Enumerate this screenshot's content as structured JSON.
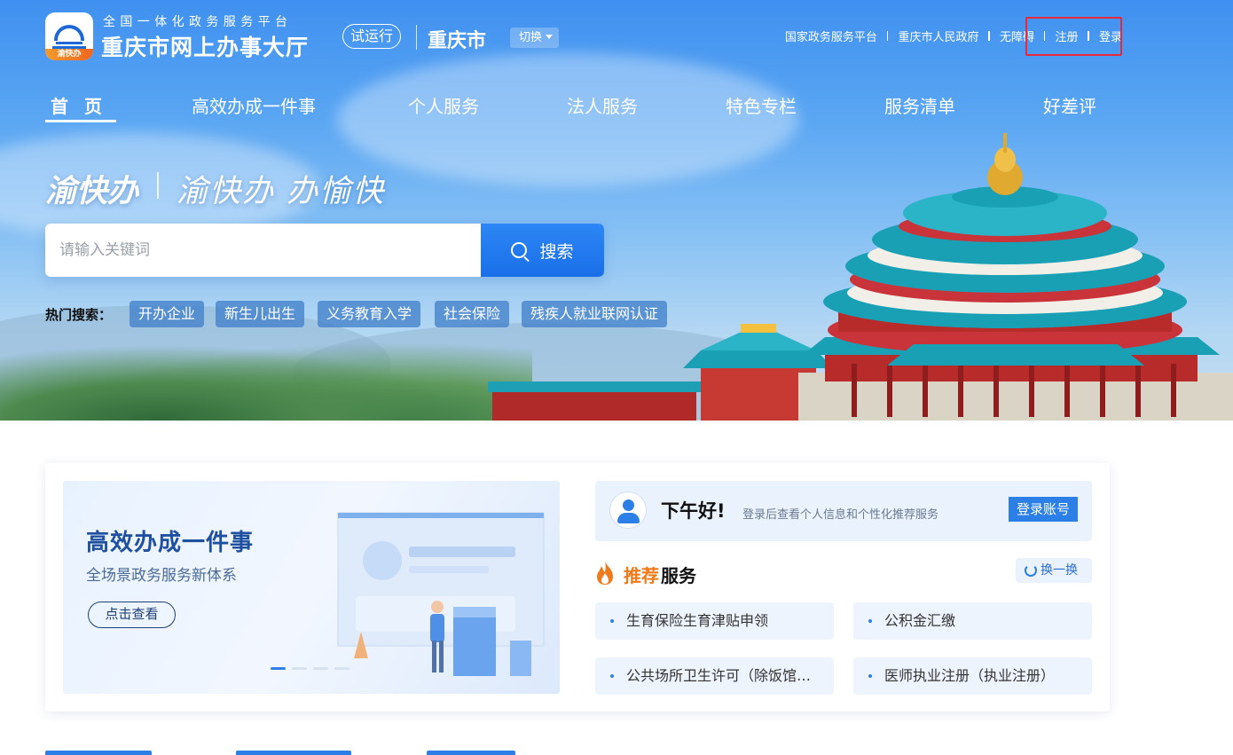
{
  "header": {
    "slogan_top": "全国一体化政务服务平台",
    "site_title": "重庆市网上办事大厅",
    "logo_text": "渝快办",
    "trial": "试运行",
    "city": "重庆市",
    "switch": "切换",
    "links": [
      "国家政务服务平台",
      "重庆市人民政府",
      "无障碍",
      "注册",
      "登录"
    ]
  },
  "nav": {
    "items": [
      "首页",
      "高效办成一件事",
      "个人服务",
      "法人服务",
      "特色专栏",
      "服务清单",
      "好差评"
    ],
    "active": "首页"
  },
  "hero": {
    "brand": "渝快办",
    "slogan": "渝快办 办愉快",
    "search_placeholder": "请输入关键词",
    "search_button": "搜索",
    "hot_label": "热门搜索：",
    "hot_tags": [
      "开办企业",
      "新生儿出生",
      "义务教育入学",
      "社会保险",
      "残疾人就业联网认证"
    ]
  },
  "banner": {
    "title": "高效办成一件事",
    "subtitle": "全场景政务服务新体系",
    "button": "点击查看",
    "dots": 4,
    "active_dot": 1
  },
  "greeting": {
    "title": "下午好!",
    "tip": "登录后查看个人信息和个性化推荐服务",
    "login_button": "登录账号"
  },
  "recommend": {
    "title_highlight": "推荐",
    "title_rest": "服务",
    "refresh": "换一换",
    "items": [
      "生育保险生育津贴申领",
      "公积金汇缴",
      "公共场所卫生许可（除饭馆、咖啡馆、酒吧、茶座）",
      "医师执业注册（执业注册）"
    ]
  },
  "colors": {
    "primary": "#2b7fe6",
    "highlight": "#e8293c",
    "accent": "#f07a1a"
  }
}
